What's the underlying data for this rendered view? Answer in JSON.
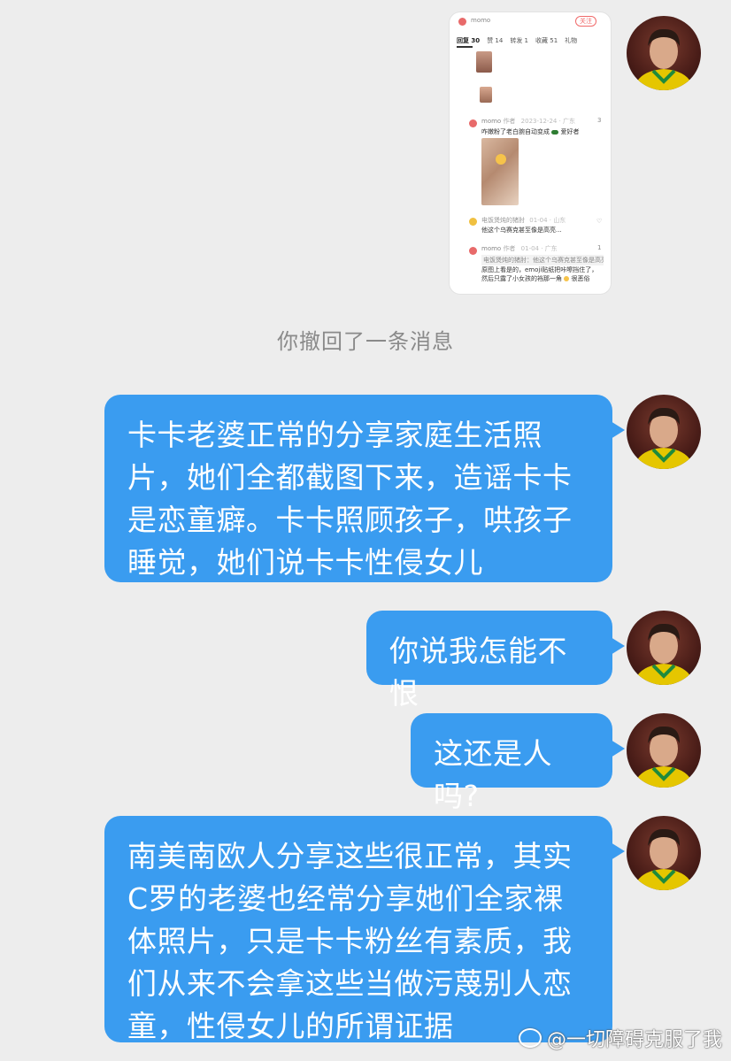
{
  "screenshot": {
    "header_name": "momo",
    "follow_label": "关注",
    "tabs": [
      "回复 30",
      "赞 14",
      "转发 1",
      "收藏 51",
      "礼物"
    ],
    "comment1": {
      "name": "momo",
      "tag": "作者",
      "time": "2023-12-24 · 广东",
      "likes": "3",
      "text": "咋嫩粉了老白腕自动变成",
      "text2": "爱好者"
    },
    "comment2": {
      "name": "电饭煲炖的猪肘",
      "time": "01-04 · 山东",
      "text": "他这个乌赛克甚至像是高亮..."
    },
    "comment3": {
      "name": "momo",
      "tag": "作者",
      "time": "01-04 · 广东",
      "likes": "1",
      "quote": "电饭煲炖的猪肘：他这个乌赛克甚至像是高亮...",
      "text": "原图上看是的，emoji贴纸把咔嚓挡住了，然后只露了小女孩的裆那一角",
      "text2": "很恶俗"
    }
  },
  "recall_notice": "你撤回了一条消息",
  "messages": [
    "卡卡老婆正常的分享家庭生活照\n片，她们全都截图下来，造谣卡卡\n是恋童癖。卡卡照顾孩子，哄孩子\n睡觉，她们说卡卡性侵女儿",
    "你说我怎能不恨",
    "这还是人吗?",
    "南美南欧人分享这些很正常，其实\nC罗的老婆也经常分享她们全家裸\n体照片，只是卡卡粉丝有素质，我\n们从来不会拿这些当做污蔑别人恋\n童，性侵女儿的所谓证据"
  ],
  "watermark": "@一切障碍克服了我",
  "colors": {
    "bubble": "#3a9cf0",
    "background": "#ededed",
    "recall_text": "#8a8a8a"
  }
}
